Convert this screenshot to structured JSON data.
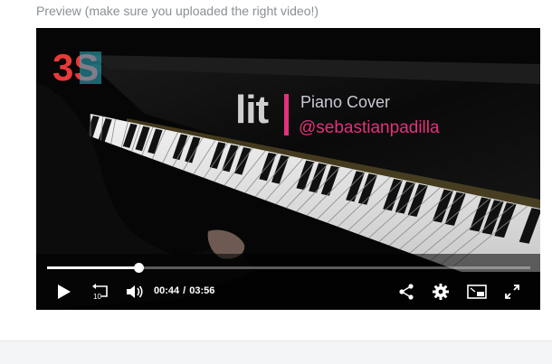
{
  "preview": {
    "label": "Preview (make sure you uploaded the right video!)"
  },
  "video": {
    "overlay": {
      "logo_text": "3S",
      "title": "lit",
      "subtitle": "Piano Cover",
      "handle": "@sebastianpadilla"
    },
    "current_time": "00:44",
    "time_separator": "/",
    "duration": "03:56",
    "progress_fraction": 0.19,
    "accent_color": "#e4317b",
    "controls": {
      "play": "play-icon",
      "rewind": "rewind-10-icon",
      "rewind_label": "10",
      "volume": "volume-icon",
      "share": "share-icon",
      "settings": "gear-icon",
      "pip": "picture-in-picture-icon",
      "fullscreen": "fullscreen-icon"
    }
  }
}
